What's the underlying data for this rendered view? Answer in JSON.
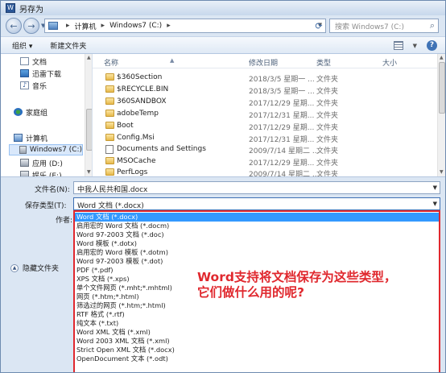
{
  "window": {
    "title": "另存为"
  },
  "address": {
    "path": [
      "计算机",
      "Windows7 (C:)"
    ],
    "separator": "▸",
    "search_placeholder": "搜索 Windows7 (C:)"
  },
  "toolbar": {
    "organize": "组织 ▾",
    "new_folder": "新建文件夹"
  },
  "nav": {
    "items": [
      {
        "label": "文档",
        "icon": "document-icon",
        "selected": false
      },
      {
        "label": "迅雷下载",
        "icon": "download-icon",
        "selected": false
      },
      {
        "label": "音乐",
        "icon": "music-icon",
        "selected": false
      },
      {
        "label": "家庭组",
        "icon": "homegroup-icon",
        "selected": false
      },
      {
        "label": "计算机",
        "icon": "computer-icon",
        "selected": false
      },
      {
        "label": "Windows7 (C:)",
        "icon": "drive-icon",
        "selected": true
      },
      {
        "label": "应用 (D:)",
        "icon": "drive-icon",
        "selected": false
      },
      {
        "label": "娱乐 (E:)",
        "icon": "drive-icon",
        "selected": false
      }
    ]
  },
  "columns": {
    "name": "名称",
    "modified": "修改日期",
    "type": "类型",
    "size": "大小"
  },
  "files": [
    {
      "name": "$360Section",
      "date": "2018/3/5 星期一 ...",
      "type": "文件夹",
      "icon": "folder-icon"
    },
    {
      "name": "$RECYCLE.BIN",
      "date": "2018/3/5 星期一 ...",
      "type": "文件夹",
      "icon": "folder-icon"
    },
    {
      "name": "360SANDBOX",
      "date": "2017/12/29 星期...",
      "type": "文件夹",
      "icon": "folder-icon"
    },
    {
      "name": "adobeTemp",
      "date": "2017/12/31 星期...",
      "type": "文件夹",
      "icon": "folder-icon"
    },
    {
      "name": "Boot",
      "date": "2017/12/29 星期...",
      "type": "文件夹",
      "icon": "folder-icon"
    },
    {
      "name": "Config.Msi",
      "date": "2017/12/31 星期...",
      "type": "文件夹",
      "icon": "folder-icon"
    },
    {
      "name": "Documents and Settings",
      "date": "2009/7/14 星期二 ...",
      "type": "文件夹",
      "icon": "shortcut-folder-icon"
    },
    {
      "name": "MSOCache",
      "date": "2017/12/29 星期...",
      "type": "文件夹",
      "icon": "folder-icon"
    },
    {
      "name": "PerfLogs",
      "date": "2009/7/14 星期二 ...",
      "type": "文件夹",
      "icon": "folder-icon"
    }
  ],
  "form": {
    "filename_label": "文件名(N):",
    "filename_value": "中我人民共和国.docx",
    "savetype_label": "保存类型(T):",
    "savetype_value": "Word 文档 (*.docx)",
    "author_label": "作者:"
  },
  "type_options": [
    "Word 文档 (*.docx)",
    "启用宏的 Word 文档 (*.docm)",
    "Word 97-2003 文档 (*.doc)",
    "Word 模板 (*.dotx)",
    "启用宏的 Word 模板 (*.dotm)",
    "Word 97-2003 模板 (*.dot)",
    "PDF (*.pdf)",
    "XPS 文档 (*.xps)",
    "单个文件网页 (*.mht;*.mhtml)",
    "网页 (*.htm;*.html)",
    "筛选过的网页 (*.htm;*.html)",
    "RTF 格式 (*.rtf)",
    "纯文本 (*.txt)",
    "Word XML 文档 (*.xml)",
    "Word 2003 XML 文档 (*.xml)",
    "Strict Open XML 文档 (*.docx)",
    "OpenDocument 文本 (*.odt)"
  ],
  "selected_type_index": 0,
  "callout": {
    "line1": "Word支持将文档保存为这些类型，",
    "line2": "它们做什么用的呢?"
  },
  "hide_folders": "隐藏文件夹",
  "colors": {
    "highlight": "#3399ff",
    "callout": "#e0282e",
    "window_bg": "#dbe6f3"
  }
}
